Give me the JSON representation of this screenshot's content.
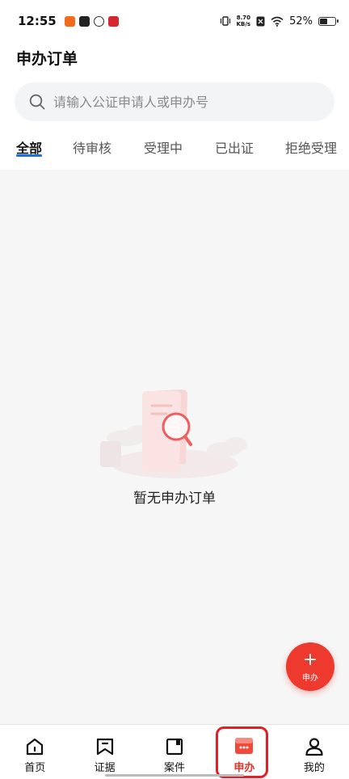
{
  "status_bar": {
    "time": "12:55",
    "net_speed_value": "8.70",
    "net_speed_unit": "KB/s",
    "battery_text": "52%",
    "battery_level": 0.52
  },
  "header": {
    "title": "申办订单"
  },
  "search": {
    "placeholder": "请输入公证申请人或申办号"
  },
  "tabs": [
    {
      "label": "全部",
      "active": true
    },
    {
      "label": "待审核"
    },
    {
      "label": "受理中"
    },
    {
      "label": "已出证"
    },
    {
      "label": "拒绝受理"
    }
  ],
  "empty_state": {
    "message": "暂无申办订单"
  },
  "fab": {
    "symbol": "+",
    "label": "申办"
  },
  "bottom_nav": [
    {
      "label": "首页",
      "icon": "home-icon"
    },
    {
      "label": "证据",
      "icon": "bookmark-icon"
    },
    {
      "label": "案件",
      "icon": "folder-icon"
    },
    {
      "label": "申办",
      "icon": "apply-icon",
      "active": true
    },
    {
      "label": "我的",
      "icon": "user-icon"
    }
  ],
  "colors": {
    "accent_blue": "#1e6fe0",
    "primary_red": "#ee3a2e",
    "highlight_red": "#e31e24"
  }
}
